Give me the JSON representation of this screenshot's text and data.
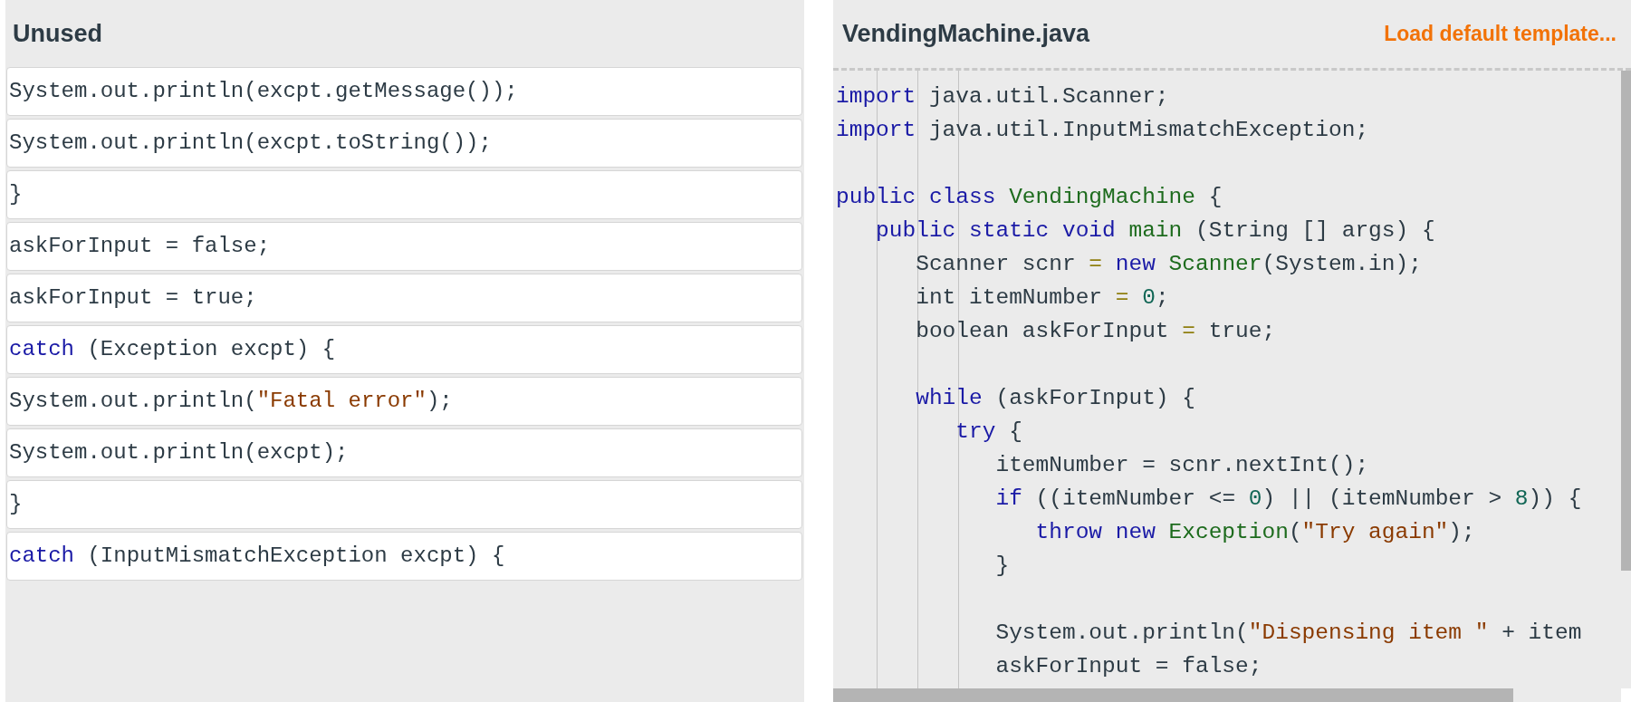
{
  "unused": {
    "title": "Unused",
    "blocks": [
      {
        "tokens": [
          {
            "kind": "plain",
            "text": "System.out.println(excpt.getMessage());"
          }
        ]
      },
      {
        "tokens": [
          {
            "kind": "plain",
            "text": "System.out.println(excpt.toString());"
          }
        ]
      },
      {
        "tokens": [
          {
            "kind": "plain",
            "text": "}"
          }
        ]
      },
      {
        "tokens": [
          {
            "kind": "plain",
            "text": "askForInput = false;"
          }
        ]
      },
      {
        "tokens": [
          {
            "kind": "plain",
            "text": "askForInput = true;"
          }
        ]
      },
      {
        "tokens": [
          {
            "kind": "keyword",
            "text": "catch"
          },
          {
            "kind": "plain",
            "text": " (Exception excpt) {"
          }
        ]
      },
      {
        "tokens": [
          {
            "kind": "plain",
            "text": "System.out.println("
          },
          {
            "kind": "string",
            "text": "\"Fatal error\""
          },
          {
            "kind": "plain",
            "text": ");"
          }
        ]
      },
      {
        "tokens": [
          {
            "kind": "plain",
            "text": "System.out.println(excpt);"
          }
        ]
      },
      {
        "tokens": [
          {
            "kind": "plain",
            "text": "}"
          }
        ]
      },
      {
        "tokens": [
          {
            "kind": "keyword",
            "text": "catch"
          },
          {
            "kind": "plain",
            "text": " (InputMismatchException excpt) {"
          }
        ]
      }
    ]
  },
  "editor": {
    "title": "VendingMachine.java",
    "link": "Load default template...",
    "lines": [
      {
        "kind": "code",
        "tokens": [
          {
            "kind": "keyword",
            "text": "import"
          },
          {
            "kind": "plain",
            "text": " java.util.Scanner;"
          }
        ]
      },
      {
        "kind": "code",
        "tokens": [
          {
            "kind": "keyword",
            "text": "import"
          },
          {
            "kind": "plain",
            "text": " java.util.InputMismatchException;"
          }
        ]
      },
      {
        "kind": "blank"
      },
      {
        "kind": "code",
        "tokens": [
          {
            "kind": "keyword",
            "text": "public class"
          },
          {
            "kind": "def",
            "text": " VendingMachine"
          },
          {
            "kind": "plain",
            "text": " {"
          }
        ]
      },
      {
        "kind": "code",
        "tokens": [
          {
            "kind": "keyword",
            "text": "   public static void"
          },
          {
            "kind": "def",
            "text": " main"
          },
          {
            "kind": "plain",
            "text": " (String [] args) {"
          }
        ]
      },
      {
        "kind": "code",
        "tokens": [
          {
            "kind": "plain",
            "text": "      Scanner scnr "
          },
          {
            "kind": "operator",
            "text": "="
          },
          {
            "kind": "keyword",
            "text": " new"
          },
          {
            "kind": "def",
            "text": " Scanner"
          },
          {
            "kind": "plain",
            "text": "(System.in);"
          }
        ]
      },
      {
        "kind": "code",
        "tokens": [
          {
            "kind": "plain",
            "text": "      int itemNumber "
          },
          {
            "kind": "operator",
            "text": "="
          },
          {
            "kind": "number",
            "text": " 0"
          },
          {
            "kind": "plain",
            "text": ";"
          }
        ]
      },
      {
        "kind": "code",
        "tokens": [
          {
            "kind": "plain",
            "text": "      boolean askForInput "
          },
          {
            "kind": "operator",
            "text": "="
          },
          {
            "kind": "plain",
            "text": " true;"
          }
        ]
      },
      {
        "kind": "blank"
      },
      {
        "kind": "code",
        "tokens": [
          {
            "kind": "keyword",
            "text": "      while"
          },
          {
            "kind": "plain",
            "text": " (askForInput) {"
          }
        ]
      },
      {
        "kind": "code",
        "tokens": [
          {
            "kind": "keyword",
            "text": "         try"
          },
          {
            "kind": "plain",
            "text": " {"
          }
        ]
      },
      {
        "kind": "code",
        "tokens": [
          {
            "kind": "plain",
            "text": "            itemNumber = scnr.nextInt();"
          }
        ]
      },
      {
        "kind": "code",
        "tokens": [
          {
            "kind": "keyword",
            "text": "            if"
          },
          {
            "kind": "plain",
            "text": " ((itemNumber <= "
          },
          {
            "kind": "number",
            "text": "0"
          },
          {
            "kind": "plain",
            "text": ") || (itemNumber > "
          },
          {
            "kind": "number",
            "text": "8"
          },
          {
            "kind": "plain",
            "text": ")) {"
          }
        ]
      },
      {
        "kind": "code",
        "tokens": [
          {
            "kind": "keyword",
            "text": "               throw new"
          },
          {
            "kind": "def",
            "text": " Exception"
          },
          {
            "kind": "plain",
            "text": "("
          },
          {
            "kind": "string",
            "text": "\"Try again\""
          },
          {
            "kind": "plain",
            "text": ");"
          }
        ]
      },
      {
        "kind": "code",
        "tokens": [
          {
            "kind": "plain",
            "text": "            }"
          }
        ]
      },
      {
        "kind": "blank"
      },
      {
        "kind": "code",
        "tokens": [
          {
            "kind": "plain",
            "text": "            System.out.println("
          },
          {
            "kind": "string",
            "text": "\"Dispensing item \""
          },
          {
            "kind": "plain",
            "text": " + item"
          }
        ]
      },
      {
        "kind": "code",
        "tokens": [
          {
            "kind": "plain",
            "text": "            askForInput = false;"
          }
        ]
      }
    ]
  }
}
